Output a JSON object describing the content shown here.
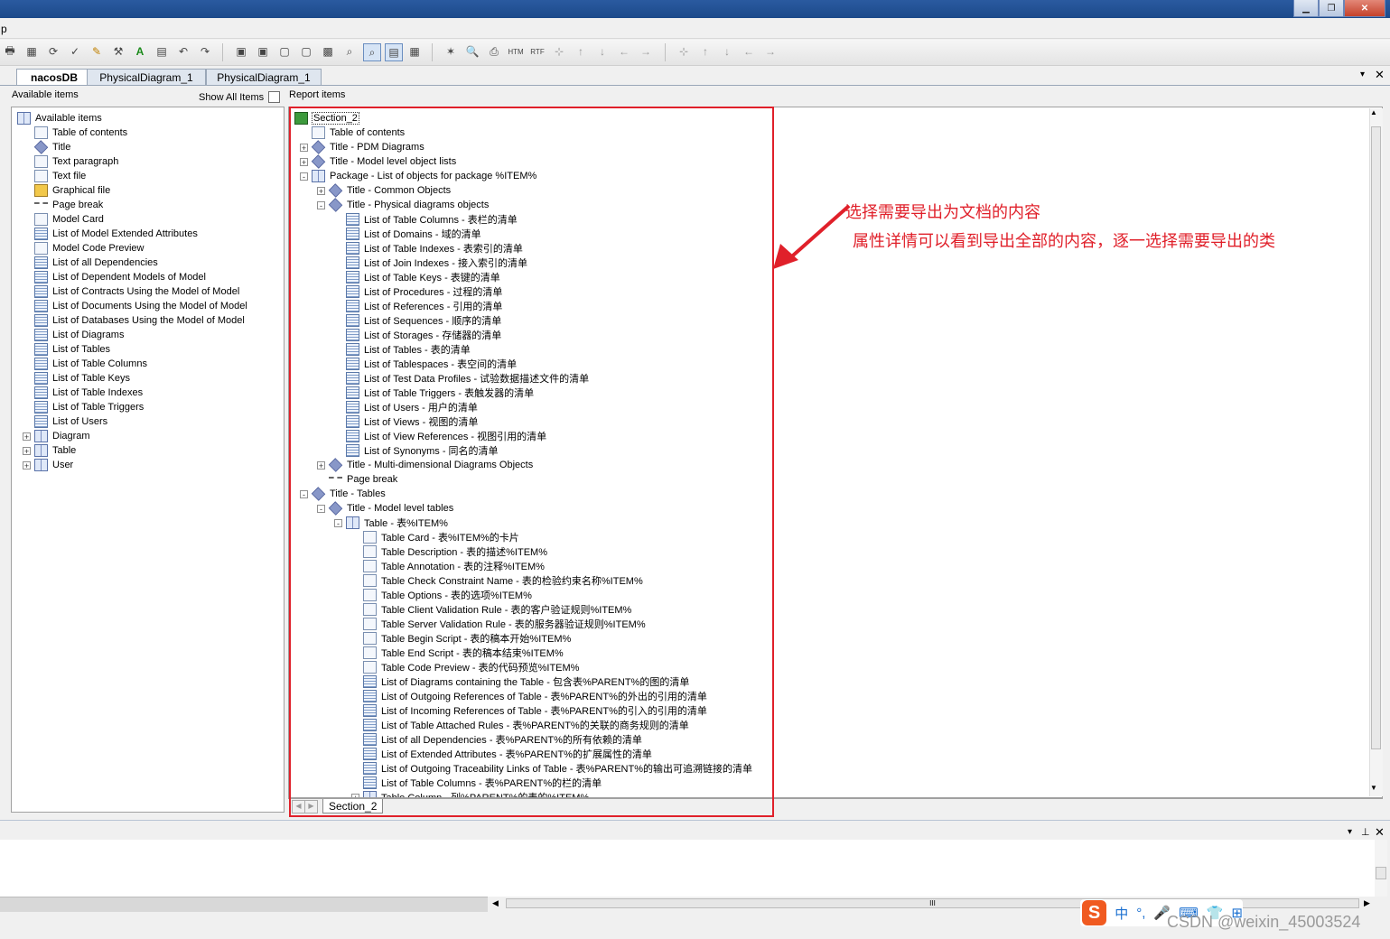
{
  "menubar": {
    "first_char": "p"
  },
  "tabs": [
    {
      "label": "nacosDB",
      "active": true
    },
    {
      "label": "PhysicalDiagram_1",
      "active": false
    },
    {
      "label": "PhysicalDiagram_1",
      "active": false
    }
  ],
  "left_panel": {
    "header": "Available items",
    "show_all_label": "Show All Items",
    "show_all_checked": false,
    "items": [
      {
        "label": "Available items",
        "icon": "book",
        "depth": 0
      },
      {
        "label": "Table of contents",
        "icon": "doc",
        "depth": 1
      },
      {
        "label": "Title",
        "icon": "title",
        "depth": 1
      },
      {
        "label": "Text paragraph",
        "icon": "doc",
        "depth": 1
      },
      {
        "label": "Text file",
        "icon": "doc",
        "depth": 1
      },
      {
        "label": "Graphical file",
        "icon": "img",
        "depth": 1
      },
      {
        "label": "Page break",
        "icon": "pgbrk",
        "depth": 1
      },
      {
        "label": "Model Card",
        "icon": "doc",
        "depth": 1
      },
      {
        "label": "List of Model Extended Attributes",
        "icon": "list",
        "depth": 1
      },
      {
        "label": "Model Code Preview",
        "icon": "doc",
        "depth": 1
      },
      {
        "label": "List of all Dependencies",
        "icon": "list",
        "depth": 1
      },
      {
        "label": "List of Dependent Models of Model",
        "icon": "list",
        "depth": 1
      },
      {
        "label": "List of Contracts Using the Model of Model",
        "icon": "list",
        "depth": 1
      },
      {
        "label": "List of Documents Using the Model of Model",
        "icon": "list",
        "depth": 1
      },
      {
        "label": "List of Databases Using the Model of Model",
        "icon": "list",
        "depth": 1
      },
      {
        "label": "List of Diagrams",
        "icon": "list",
        "depth": 1
      },
      {
        "label": "List of Tables",
        "icon": "list",
        "depth": 1
      },
      {
        "label": "List of Table Columns",
        "icon": "list",
        "depth": 1
      },
      {
        "label": "List of Table Keys",
        "icon": "list",
        "depth": 1
      },
      {
        "label": "List of Table Indexes",
        "icon": "list",
        "depth": 1
      },
      {
        "label": "List of Table Triggers",
        "icon": "list",
        "depth": 1
      },
      {
        "label": "List of Users",
        "icon": "list",
        "depth": 1
      },
      {
        "label": "Diagram",
        "icon": "book",
        "depth": 1,
        "expander": "+"
      },
      {
        "label": "Table",
        "icon": "book",
        "depth": 1,
        "expander": "+"
      },
      {
        "label": "User",
        "icon": "book",
        "depth": 1,
        "expander": "+"
      }
    ]
  },
  "right_panel": {
    "header": "Report items",
    "items": [
      {
        "label": "Section_2",
        "icon": "section",
        "depth": 0,
        "selected": true
      },
      {
        "label": "Table of contents",
        "icon": "doc",
        "depth": 1
      },
      {
        "label": "Title - PDM Diagrams",
        "icon": "title",
        "depth": 1,
        "expander": "+"
      },
      {
        "label": "Title - Model level object lists",
        "icon": "title",
        "depth": 1,
        "expander": "+"
      },
      {
        "label": "Package - List of objects for package %ITEM%",
        "icon": "book",
        "depth": 1,
        "expander": "-"
      },
      {
        "label": "Title - Common Objects",
        "icon": "title",
        "depth": 2,
        "expander": "+"
      },
      {
        "label": "Title - Physical diagrams objects",
        "icon": "title",
        "depth": 2,
        "expander": "-"
      },
      {
        "label": "List of Table Columns - 表栏的清单",
        "icon": "list",
        "depth": 3
      },
      {
        "label": "List of Domains - 域的清单",
        "icon": "list",
        "depth": 3
      },
      {
        "label": "List of Table Indexes - 表索引的清单",
        "icon": "list",
        "depth": 3
      },
      {
        "label": "List of Join Indexes - 接入索引的清单",
        "icon": "list",
        "depth": 3
      },
      {
        "label": "List of Table Keys - 表键的清单",
        "icon": "list",
        "depth": 3
      },
      {
        "label": "List of Procedures - 过程的清单",
        "icon": "list",
        "depth": 3
      },
      {
        "label": "List of References - 引用的清单",
        "icon": "list",
        "depth": 3
      },
      {
        "label": "List of Sequences - 顺序的清单",
        "icon": "list",
        "depth": 3
      },
      {
        "label": "List of Storages - 存储器的清单",
        "icon": "list",
        "depth": 3
      },
      {
        "label": "List of Tables - 表的清单",
        "icon": "list",
        "depth": 3
      },
      {
        "label": "List of Tablespaces - 表空间的清单",
        "icon": "list",
        "depth": 3
      },
      {
        "label": "List of Test Data Profiles - 试验数据描述文件的清单",
        "icon": "list",
        "depth": 3
      },
      {
        "label": "List of Table Triggers - 表触发器的清单",
        "icon": "list",
        "depth": 3
      },
      {
        "label": "List of Users - 用户的清单",
        "icon": "list",
        "depth": 3
      },
      {
        "label": "List of Views - 视图的清单",
        "icon": "list",
        "depth": 3
      },
      {
        "label": "List of View References - 视图引用的清单",
        "icon": "list",
        "depth": 3
      },
      {
        "label": "List of Synonyms - 同名的清单",
        "icon": "list",
        "depth": 3
      },
      {
        "label": "Title - Multi-dimensional Diagrams Objects",
        "icon": "title",
        "depth": 2,
        "expander": "+"
      },
      {
        "label": "Page break",
        "icon": "pgbrk",
        "depth": 2
      },
      {
        "label": "Title - Tables",
        "icon": "title",
        "depth": 1,
        "expander": "-"
      },
      {
        "label": "Title - Model level tables",
        "icon": "title",
        "depth": 2,
        "expander": "-"
      },
      {
        "label": "Table - 表%ITEM%",
        "icon": "book",
        "depth": 3,
        "expander": "-"
      },
      {
        "label": "Table Card - 表%ITEM%的卡片",
        "icon": "doc",
        "depth": 4
      },
      {
        "label": "Table Description - 表的描述%ITEM%",
        "icon": "doc",
        "depth": 4
      },
      {
        "label": "Table Annotation - 表的注释%ITEM%",
        "icon": "doc",
        "depth": 4
      },
      {
        "label": "Table Check Constraint Name - 表的检验约束名称%ITEM%",
        "icon": "doc",
        "depth": 4
      },
      {
        "label": "Table Options - 表的选项%ITEM%",
        "icon": "doc",
        "depth": 4
      },
      {
        "label": "Table Client Validation Rule - 表的客户验证规则%ITEM%",
        "icon": "doc",
        "depth": 4
      },
      {
        "label": "Table Server Validation Rule - 表的服务器验证规则%ITEM%",
        "icon": "doc",
        "depth": 4
      },
      {
        "label": "Table Begin Script - 表的稿本开始%ITEM%",
        "icon": "doc",
        "depth": 4
      },
      {
        "label": "Table End Script - 表的稿本结束%ITEM%",
        "icon": "doc",
        "depth": 4
      },
      {
        "label": "Table Code Preview - 表的代码预览%ITEM%",
        "icon": "doc",
        "depth": 4
      },
      {
        "label": "List of Diagrams containing the Table - 包含表%PARENT%的图的清单",
        "icon": "list",
        "depth": 4
      },
      {
        "label": "List of Outgoing References of Table - 表%PARENT%的外出的引用的清单",
        "icon": "list",
        "depth": 4
      },
      {
        "label": "List of Incoming References of Table - 表%PARENT%的引入的引用的清单",
        "icon": "list",
        "depth": 4
      },
      {
        "label": "List of Table Attached Rules - 表%PARENT%的关联的商务规则的清单",
        "icon": "list",
        "depth": 4
      },
      {
        "label": "List of all Dependencies - 表%PARENT%的所有依赖的清单",
        "icon": "list",
        "depth": 4
      },
      {
        "label": "List of Extended Attributes - 表%PARENT%的扩展属性的清单",
        "icon": "list",
        "depth": 4
      },
      {
        "label": "List of Outgoing Traceability Links of Table - 表%PARENT%的输出可追溯链接的清单",
        "icon": "list",
        "depth": 4
      },
      {
        "label": "List of Table Columns - 表%PARENT%的栏的清单",
        "icon": "list",
        "depth": 4
      },
      {
        "label": "Table Column - 列%PARENT%的表的%ITEM%",
        "icon": "book",
        "depth": 4,
        "expander": "+"
      }
    ],
    "section_tab": "Section_2"
  },
  "annotation": {
    "line1": "选择需要导出为文档的内容",
    "line2": "属性详情可以看到导出全部的内容，逐一选择需要导出的类",
    "color": "#e0202a"
  },
  "ime": {
    "chars": [
      "中",
      "°,",
      "🎤",
      "⌨",
      "👕",
      "⊞"
    ]
  },
  "watermark": "CSDN @weixin_45003524",
  "scroll_grip": "III"
}
